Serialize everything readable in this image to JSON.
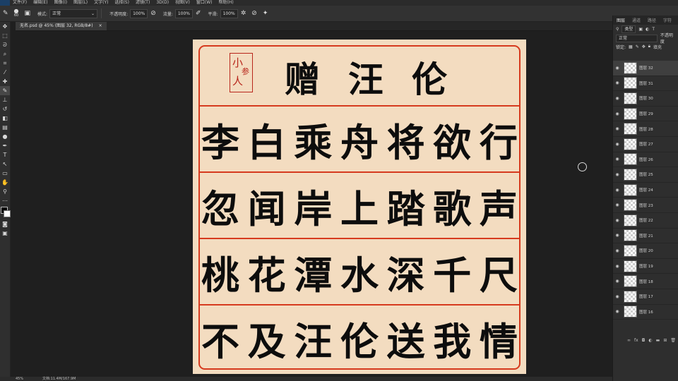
{
  "menu": [
    "文件(F)",
    "编辑(E)",
    "图像(I)",
    "图层(L)",
    "文字(Y)",
    "选择(S)",
    "滤镜(T)",
    "3D(D)",
    "视图(V)",
    "窗口(W)",
    "帮助(H)"
  ],
  "options": {
    "brush_size": "60",
    "mode_label": "模式:",
    "mode_value": "正常",
    "opacity_label": "不透明度:",
    "opacity_value": "100%",
    "flow_label": "流量:",
    "flow_value": "100%",
    "smooth_label": "平滑:",
    "smooth_value": "100%"
  },
  "document_tab": {
    "title": "无名.psd @ 45% (图层 32, RGB/8#)",
    "close": "×"
  },
  "status": {
    "zoom": "45%",
    "doc_info": "文档:11.4M/167.9M"
  },
  "artwork": {
    "rows": [
      [
        "赠",
        "汪",
        "伦"
      ],
      [
        "李",
        "白",
        "乘",
        "舟",
        "将",
        "欲",
        "行"
      ],
      [
        "忽",
        "闻",
        "岸",
        "上",
        "踏",
        "歌",
        "声"
      ],
      [
        "桃",
        "花",
        "潭",
        "水",
        "深",
        "千",
        "尺"
      ],
      [
        "不",
        "及",
        "汪",
        "伦",
        "送",
        "我",
        "情"
      ]
    ],
    "seal": [
      "小",
      "人",
      "参"
    ]
  },
  "panel": {
    "tabs": [
      "图层",
      "通道",
      "路径",
      "字符"
    ],
    "filter_label": "类型",
    "blend_mode": "正常",
    "opacity_label": "不透明度",
    "lock_label": "锁定:",
    "fill_label": "填充",
    "layers": [
      "图层 32",
      "图层 31",
      "图层 30",
      "图层 29",
      "图层 28",
      "图层 27",
      "图层 26",
      "图层 25",
      "图层 24",
      "图层 23",
      "图层 22",
      "图层 21",
      "图层 20",
      "图层 19",
      "图层 18",
      "图层 17",
      "图层 16"
    ],
    "footer_icons": [
      "link-icon",
      "fx-icon",
      "mask-icon",
      "adjustment-icon",
      "folder-icon",
      "new-layer-icon",
      "delete-icon"
    ]
  },
  "colors": {
    "accent_red": "#d63a1e",
    "paper": "#f3dcc0",
    "seal_red": "#b8261b"
  }
}
